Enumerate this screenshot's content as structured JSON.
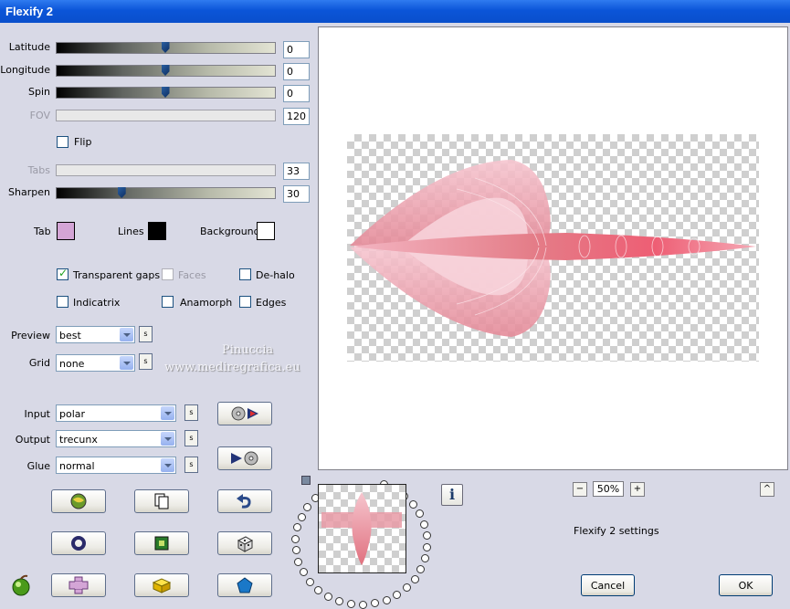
{
  "window": {
    "title": "Flexify 2"
  },
  "sliders": {
    "latitude": {
      "label": "Latitude",
      "value": "0",
      "level": 0.5
    },
    "longitude": {
      "label": "Longitude",
      "value": "0",
      "level": 0.5
    },
    "spin": {
      "label": "Spin",
      "value": "0",
      "level": 0.5
    },
    "fov": {
      "label": "FOV",
      "value": "120"
    },
    "tabs": {
      "label": "Tabs",
      "value": "33"
    },
    "sharpen": {
      "label": "Sharpen",
      "value": "30",
      "level": 0.3
    }
  },
  "flip": {
    "label": "Flip",
    "checked": false
  },
  "colors": {
    "tab": {
      "label": "Tab",
      "color": "#d4a5d6"
    },
    "lines": {
      "label": "Lines",
      "color": "#000000"
    },
    "background": {
      "label": "Background",
      "color": "#ffffff"
    }
  },
  "options": {
    "transparent_gaps": {
      "label": "Transparent gaps",
      "checked": true
    },
    "faces": {
      "label": "Faces",
      "checked": false,
      "disabled": true
    },
    "de_halo": {
      "label": "De-halo",
      "checked": false
    },
    "indicatrix": {
      "label": "Indicatrix",
      "checked": false
    },
    "anamorph": {
      "label": "Anamorph",
      "checked": false
    },
    "edges": {
      "label": "Edges",
      "checked": false
    }
  },
  "selects": {
    "preview": {
      "label": "Preview",
      "value": "best"
    },
    "grid": {
      "label": "Grid",
      "value": "none"
    },
    "input": {
      "label": "Input",
      "value": "polar"
    },
    "output": {
      "label": "Output",
      "value": "trecunx"
    },
    "glue": {
      "label": "Glue",
      "value": "normal"
    }
  },
  "s_label": "s",
  "watermark": {
    "line1": "Pinuccia",
    "line2": "www.mediregrafica.eu"
  },
  "zoom": {
    "minus": "−",
    "value": "50%",
    "plus": "+"
  },
  "collapse_label": "^",
  "settings_label": "Flexify 2 settings",
  "info_label": "i",
  "buttons": {
    "cancel": "Cancel",
    "ok": "OK"
  },
  "accent_colors": {
    "title_bar": "#0b55d8",
    "shape_pink": "#f07a8a",
    "shape_light": "#f2b8c4"
  }
}
